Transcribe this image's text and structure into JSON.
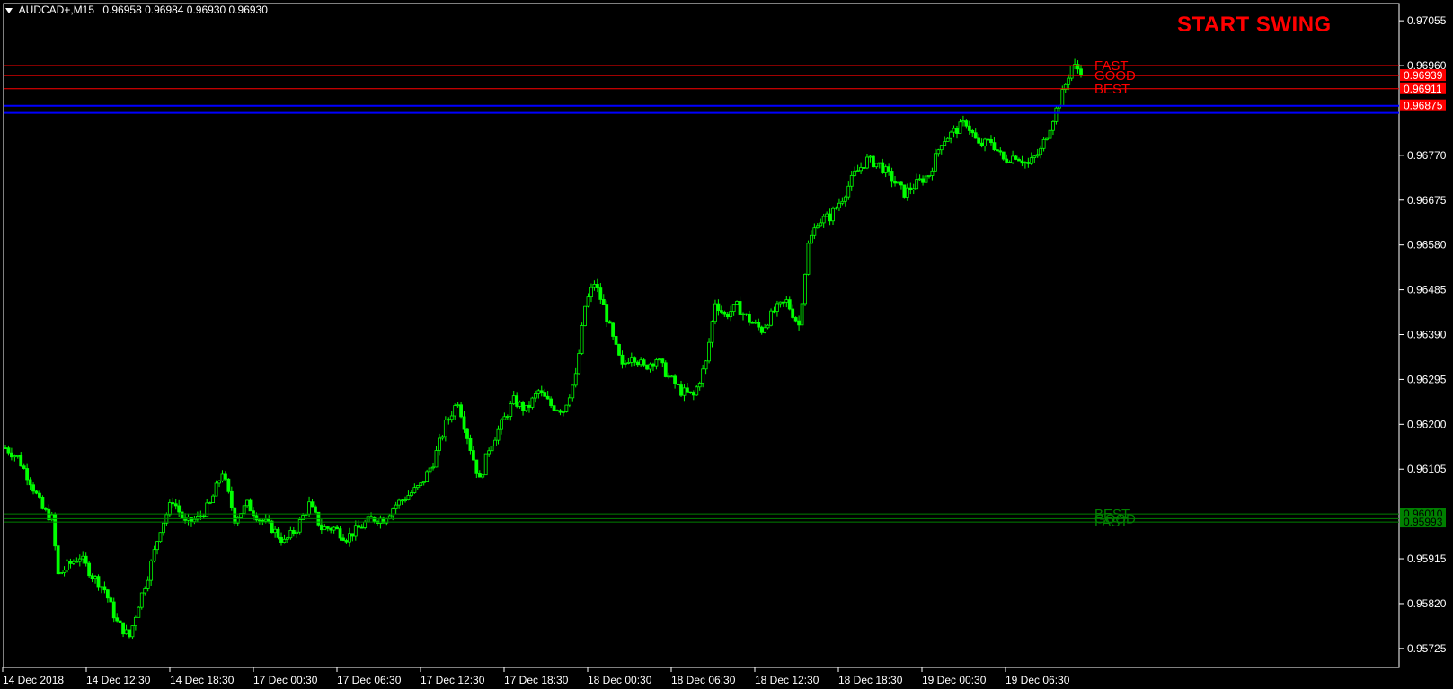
{
  "header": {
    "symbol": "AUDCAD+,M15",
    "ohlc": "0.96958 0.96984 0.96930 0.96930"
  },
  "signal_title": "START SWING",
  "colors": {
    "background": "#000000",
    "frame": "#ffffff",
    "candle": "#00ff00",
    "resistance": "#ff0000",
    "support": "#008000",
    "highlight_line": "#0000ff",
    "signal_title": "#ff0000"
  },
  "chart_data": {
    "type": "candlestick",
    "instrument": "AUDCAD+",
    "timeframe": "M15",
    "price_axis": {
      "ticks": [
        "0.97055",
        "0.96960",
        "0.96770",
        "0.96675",
        "0.96580",
        "0.96485",
        "0.96390",
        "0.96295",
        "0.96200",
        "0.96105",
        "0.95915",
        "0.95820",
        "0.95725"
      ],
      "range": [
        0.957,
        0.9708
      ]
    },
    "time_axis": {
      "ticks": [
        "14 Dec 2018",
        "14 Dec 12:30",
        "14 Dec 18:30",
        "17 Dec 00:30",
        "17 Dec 06:30",
        "17 Dec 12:30",
        "17 Dec 18:30",
        "18 Dec 00:30",
        "18 Dec 06:30",
        "18 Dec 12:30",
        "18 Dec 18:30",
        "19 Dec 00:30",
        "19 Dec 06:30"
      ]
    },
    "close_path": [
      [
        0,
        0.9615
      ],
      [
        4,
        0.9613
      ],
      [
        8,
        0.9608
      ],
      [
        12,
        0.9602
      ],
      [
        15,
        0.96
      ],
      [
        17,
        0.9588
      ],
      [
        20,
        0.959
      ],
      [
        24,
        0.9592
      ],
      [
        28,
        0.9588
      ],
      [
        32,
        0.9585
      ],
      [
        36,
        0.9578
      ],
      [
        40,
        0.9575
      ],
      [
        43,
        0.9582
      ],
      [
        46,
        0.9588
      ],
      [
        50,
        0.9598
      ],
      [
        54,
        0.9604
      ],
      [
        58,
        0.9599
      ],
      [
        62,
        0.96
      ],
      [
        66,
        0.9603
      ],
      [
        70,
        0.961
      ],
      [
        74,
        0.96
      ],
      [
        78,
        0.9603
      ],
      [
        82,
        0.96
      ],
      [
        86,
        0.9598
      ],
      [
        90,
        0.9595
      ],
      [
        94,
        0.9598
      ],
      [
        98,
        0.9603
      ],
      [
        102,
        0.9598
      ],
      [
        106,
        0.9598
      ],
      [
        110,
        0.9596
      ],
      [
        114,
        0.9598
      ],
      [
        118,
        0.96
      ],
      [
        122,
        0.96
      ],
      [
        126,
        0.9603
      ],
      [
        130,
        0.9605
      ],
      [
        134,
        0.9607
      ],
      [
        138,
        0.9612
      ],
      [
        142,
        0.962
      ],
      [
        146,
        0.9625
      ],
      [
        150,
        0.9615
      ],
      [
        153,
        0.9608
      ],
      [
        156,
        0.9615
      ],
      [
        160,
        0.962
      ],
      [
        164,
        0.9625
      ],
      [
        168,
        0.9623
      ],
      [
        172,
        0.9627
      ],
      [
        176,
        0.9624
      ],
      [
        180,
        0.9623
      ],
      [
        184,
        0.963
      ],
      [
        187,
        0.9645
      ],
      [
        190,
        0.965
      ],
      [
        193,
        0.9645
      ],
      [
        196,
        0.9638
      ],
      [
        199,
        0.9632
      ],
      [
        202,
        0.9635
      ],
      [
        206,
        0.9632
      ],
      [
        210,
        0.9634
      ],
      [
        214,
        0.963
      ],
      [
        218,
        0.9627
      ],
      [
        222,
        0.9626
      ],
      [
        226,
        0.9633
      ],
      [
        229,
        0.9646
      ],
      [
        232,
        0.9643
      ],
      [
        236,
        0.9645
      ],
      [
        240,
        0.9642
      ],
      [
        244,
        0.964
      ],
      [
        248,
        0.9644
      ],
      [
        252,
        0.9646
      ],
      [
        256,
        0.9641
      ],
      [
        259,
        0.9658
      ],
      [
        262,
        0.9663
      ],
      [
        266,
        0.9664
      ],
      [
        270,
        0.9668
      ],
      [
        274,
        0.9673
      ],
      [
        278,
        0.9676
      ],
      [
        282,
        0.9675
      ],
      [
        286,
        0.9672
      ],
      [
        290,
        0.9669
      ],
      [
        294,
        0.9671
      ],
      [
        298,
        0.9673
      ],
      [
        302,
        0.968
      ],
      [
        306,
        0.9682
      ],
      [
        310,
        0.9684
      ],
      [
        314,
        0.9679
      ],
      [
        318,
        0.968
      ],
      [
        322,
        0.9676
      ],
      [
        326,
        0.9677
      ],
      [
        330,
        0.9675
      ],
      [
        334,
        0.9678
      ],
      [
        338,
        0.9685
      ],
      [
        341,
        0.969
      ],
      [
        344,
        0.9696
      ],
      [
        347,
        0.9695
      ]
    ],
    "annotations": [
      {
        "label": "FAST",
        "price": 0.9696,
        "group": "resistance"
      },
      {
        "label": "GOOD",
        "price": 0.96939,
        "group": "resistance"
      },
      {
        "label": "BEST",
        "price": 0.96911,
        "group": "resistance"
      },
      {
        "label": "BEST",
        "price": 0.9601,
        "group": "support"
      },
      {
        "label": "GOOD",
        "price": 0.96,
        "group": "support"
      },
      {
        "label": "FAST",
        "price": 0.95993,
        "group": "support"
      }
    ],
    "price_tags": [
      {
        "text": "0.96939",
        "group": "resistance"
      },
      {
        "text": "0.96911",
        "group": "resistance"
      },
      {
        "text": "0.96875",
        "group": "resistance"
      },
      {
        "text": "0.96010",
        "group": "support"
      },
      {
        "text": "0.95993",
        "group": "support"
      }
    ],
    "horizontal_lines": [
      {
        "price": 0.9696,
        "color": "#ff0000"
      },
      {
        "price": 0.96939,
        "color": "#ff0000"
      },
      {
        "price": 0.96911,
        "color": "#ff0000"
      },
      {
        "price": 0.96875,
        "color": "#0000ff"
      },
      {
        "price": 0.9686,
        "color": "#0000ff"
      },
      {
        "price": 0.9601,
        "color": "#008000"
      },
      {
        "price": 0.96,
        "color": "#008000"
      },
      {
        "price": 0.95993,
        "color": "#008000"
      }
    ]
  }
}
